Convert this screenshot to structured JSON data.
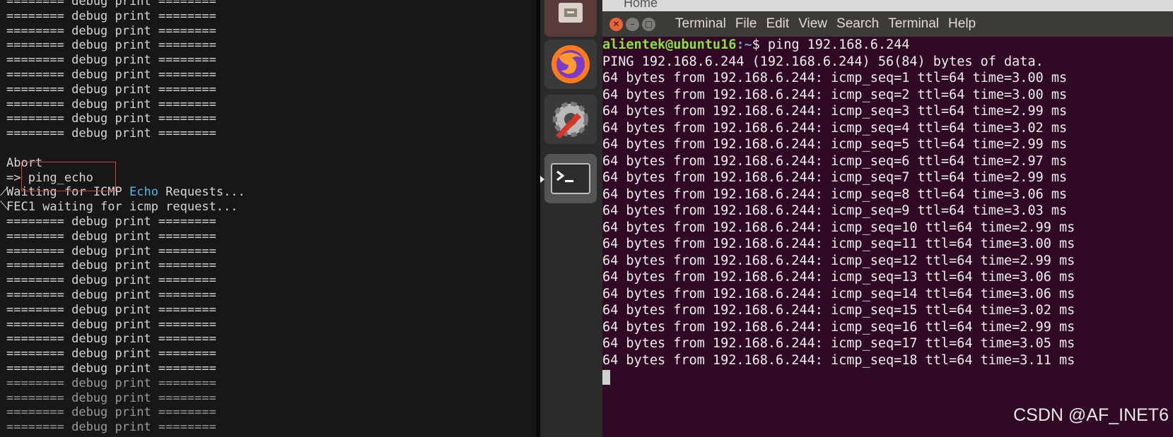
{
  "left_console": {
    "lines_before": [
      "======== debug print ========",
      "======== debug print ========",
      "======== debug print ========",
      "======== debug print ========",
      "======== debug print ========",
      "======== debug print ========",
      "======== debug print ========",
      "======== debug print ========",
      "======== debug print ========",
      "======== debug print ========",
      ""
    ],
    "abort": "Abort",
    "prompt": "=> ",
    "command": "ping_echo",
    "waiting_prefix": "Waiting for ICMP ",
    "waiting_highlight": "Echo",
    "waiting_suffix": " Requests...",
    "fec_line": "FEC1 waiting for icmp request...",
    "lines_after": [
      "======== debug print ========",
      "======== debug print ========",
      "======== debug print ========",
      "======== debug print ========",
      "======== debug print ========",
      "======== debug print ========",
      "======== debug print ========",
      "======== debug print ========",
      "======== debug print ========",
      "======== debug print ========",
      "======== debug print ========",
      "======== debug print ========",
      "======== debug print ========",
      "======== debug print ========",
      "======== debug print ========"
    ]
  },
  "launcher": {
    "items": [
      "files-icon",
      "firefox-icon",
      "system-settings-icon",
      "terminal-icon"
    ]
  },
  "home_peek": "Home",
  "terminal": {
    "menu": [
      "Terminal",
      "File",
      "Edit",
      "View",
      "Search",
      "Terminal",
      "Help"
    ],
    "prompt_user": "alientek@ubuntu16",
    "prompt_path": ":~",
    "prompt_symbol": "$ ",
    "command": "ping 192.168.6.244",
    "ping_header": "PING 192.168.6.244 (192.168.6.244) 56(84) bytes of data.",
    "replies": [
      "64 bytes from 192.168.6.244: icmp_seq=1 ttl=64 time=3.00 ms",
      "64 bytes from 192.168.6.244: icmp_seq=2 ttl=64 time=3.00 ms",
      "64 bytes from 192.168.6.244: icmp_seq=3 ttl=64 time=2.99 ms",
      "64 bytes from 192.168.6.244: icmp_seq=4 ttl=64 time=3.02 ms",
      "64 bytes from 192.168.6.244: icmp_seq=5 ttl=64 time=2.99 ms",
      "64 bytes from 192.168.6.244: icmp_seq=6 ttl=64 time=2.97 ms",
      "64 bytes from 192.168.6.244: icmp_seq=7 ttl=64 time=2.99 ms",
      "64 bytes from 192.168.6.244: icmp_seq=8 ttl=64 time=3.06 ms",
      "64 bytes from 192.168.6.244: icmp_seq=9 ttl=64 time=3.03 ms",
      "64 bytes from 192.168.6.244: icmp_seq=10 ttl=64 time=2.99 ms",
      "64 bytes from 192.168.6.244: icmp_seq=11 ttl=64 time=3.00 ms",
      "64 bytes from 192.168.6.244: icmp_seq=12 ttl=64 time=2.99 ms",
      "64 bytes from 192.168.6.244: icmp_seq=13 ttl=64 time=3.06 ms",
      "64 bytes from 192.168.6.244: icmp_seq=14 ttl=64 time=3.06 ms",
      "64 bytes from 192.168.6.244: icmp_seq=15 ttl=64 time=3.02 ms",
      "64 bytes from 192.168.6.244: icmp_seq=16 ttl=64 time=2.99 ms",
      "64 bytes from 192.168.6.244: icmp_seq=17 ttl=64 time=3.05 ms",
      "64 bytes from 192.168.6.244: icmp_seq=18 ttl=64 time=3.11 ms"
    ]
  },
  "watermark": "CSDN @AF_INET6",
  "colors": {
    "terminal_bg": "#300a24",
    "prompt_user": "#8ae234",
    "prompt_path": "#729fcf",
    "highlight_box": "#e23b3b",
    "echo_word": "#4fb8e6"
  }
}
